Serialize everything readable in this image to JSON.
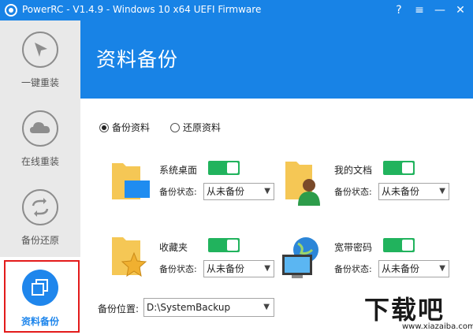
{
  "window": {
    "title": "PowerRC - V1.4.9 - Windows 10 x64 UEFI Firmware",
    "controls": {
      "help": "?",
      "menu": "≡",
      "minimize": "—",
      "close": "✕"
    }
  },
  "sidebar": {
    "items": [
      {
        "label": "一键重装",
        "icon": "cursor-arrow-icon"
      },
      {
        "label": "在线重装",
        "icon": "cloud-icon"
      },
      {
        "label": "备份还原",
        "icon": "refresh-arrows-icon"
      },
      {
        "label": "资料备份",
        "icon": "copy-squares-icon",
        "active": true
      }
    ]
  },
  "header": {
    "title": "资料备份"
  },
  "mode": {
    "options": [
      {
        "label": "备份资料",
        "checked": true
      },
      {
        "label": "还原资料",
        "checked": false
      }
    ]
  },
  "items": [
    {
      "name": "系统桌面",
      "status_label": "备份状态:",
      "status_value": "从未备份",
      "enabled": true,
      "icon": "desktop-folder-icon"
    },
    {
      "name": "我的文档",
      "status_label": "备份状态:",
      "status_value": "从未备份",
      "enabled": true,
      "icon": "documents-folder-icon"
    },
    {
      "name": "收藏夹",
      "status_label": "备份状态:",
      "status_value": "从未备份",
      "enabled": true,
      "icon": "favorites-folder-icon"
    },
    {
      "name": "宽带密码",
      "status_label": "备份状态:",
      "status_value": "从未备份",
      "enabled": true,
      "icon": "network-globe-icon"
    }
  ],
  "backup_path": {
    "label": "备份位置:",
    "value": "D:\\SystemBackup"
  },
  "watermark": {
    "logo_text": "下载吧",
    "url": "www.xiazaiba.com"
  },
  "colors": {
    "accent": "#1883e6",
    "toggle_on": "#21b35d",
    "highlight": "#e31b1b",
    "sidebar_bg": "#e9e9e9"
  }
}
